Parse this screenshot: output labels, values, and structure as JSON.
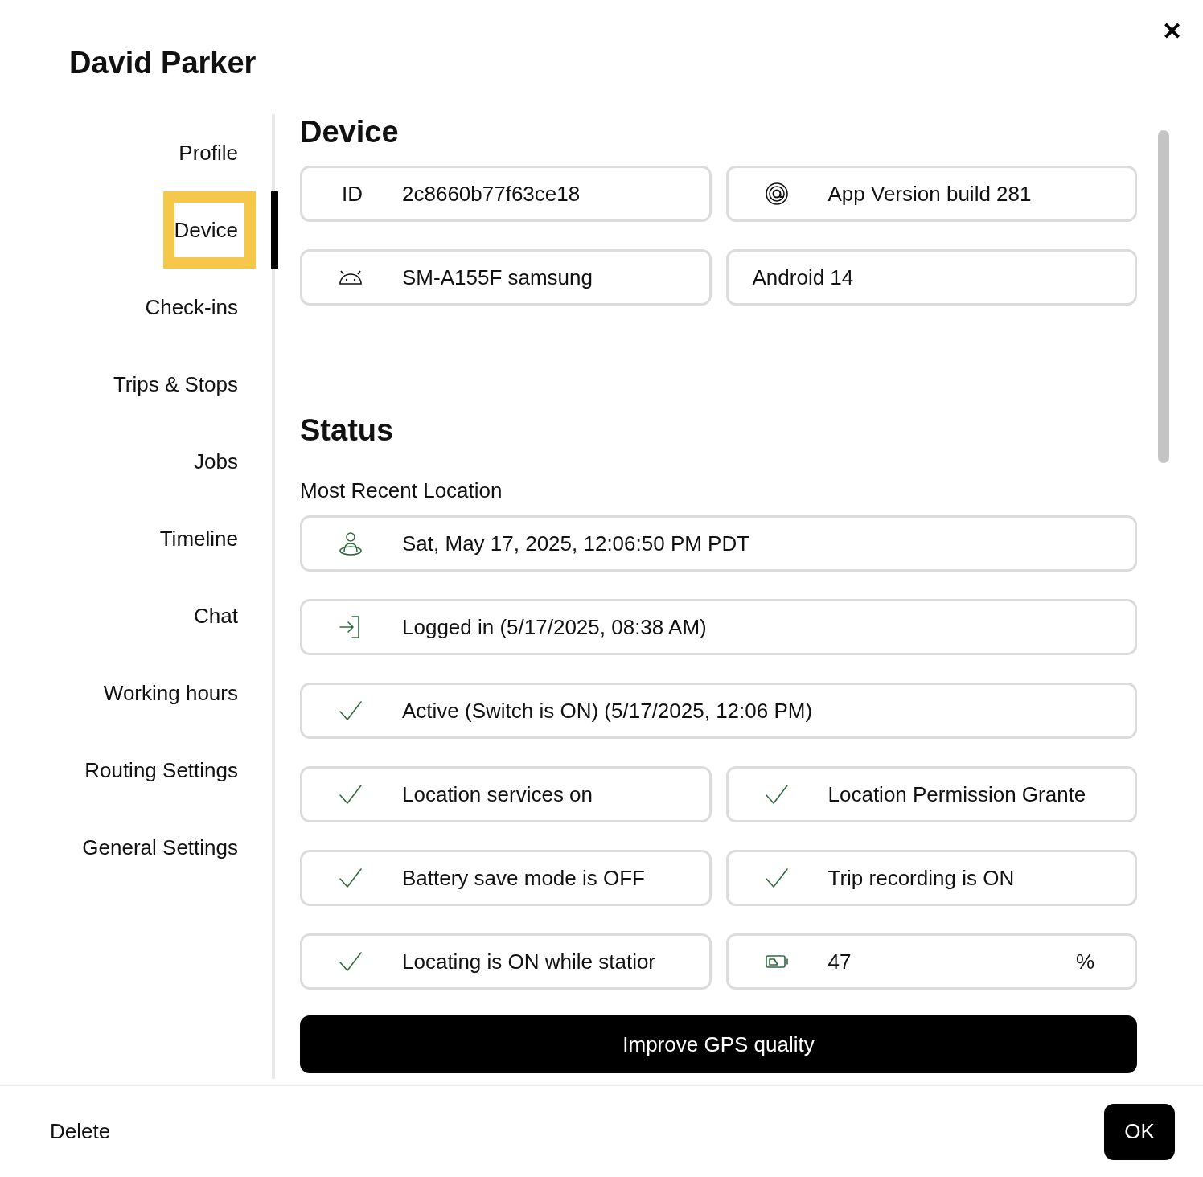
{
  "title": "David Parker",
  "close": "✕",
  "sidebar": {
    "items": [
      {
        "label": "Profile",
        "selected": false
      },
      {
        "label": "Device",
        "selected": true
      },
      {
        "label": "Check-ins",
        "selected": false
      },
      {
        "label": "Trips & Stops",
        "selected": false
      },
      {
        "label": "Jobs",
        "selected": false
      },
      {
        "label": "Timeline",
        "selected": false
      },
      {
        "label": "Chat",
        "selected": false
      },
      {
        "label": "Working hours",
        "selected": false
      },
      {
        "label": "Routing Settings",
        "selected": false
      },
      {
        "label": "General Settings",
        "selected": false
      }
    ]
  },
  "device": {
    "heading": "Device",
    "rows": [
      [
        {
          "kind": "id",
          "label": "ID",
          "value": "2c8660b77f63ce18"
        },
        {
          "kind": "app",
          "value": "App Version build 281"
        }
      ],
      [
        {
          "kind": "android",
          "value": "SM-A155F samsung"
        },
        {
          "kind": "plain",
          "value": "Android 14"
        }
      ]
    ]
  },
  "status": {
    "heading": "Status",
    "subheading": "Most Recent Location",
    "rows": [
      [
        {
          "kind": "location",
          "value": "Sat, May 17, 2025, 12:06:50 PM PDT"
        }
      ],
      [
        {
          "kind": "login",
          "value": "Logged in (5/17/2025, 08:38 AM)"
        }
      ],
      [
        {
          "kind": "check",
          "value": "Active (Switch is ON) (5/17/2025, 12:06 PM)"
        }
      ],
      [
        {
          "kind": "check",
          "value": "Location services on"
        },
        {
          "kind": "check",
          "value": "Location Permission Grante"
        }
      ],
      [
        {
          "kind": "check",
          "value": "Battery save mode is OFF"
        },
        {
          "kind": "check",
          "value": "Trip recording is ON"
        }
      ],
      [
        {
          "kind": "check",
          "value": "Locating is ON while statior"
        },
        {
          "kind": "battery",
          "value": "47",
          "unit": "%"
        }
      ]
    ]
  },
  "action_button": "Improve GPS quality",
  "footer": {
    "delete": "Delete",
    "ok": "OK"
  }
}
